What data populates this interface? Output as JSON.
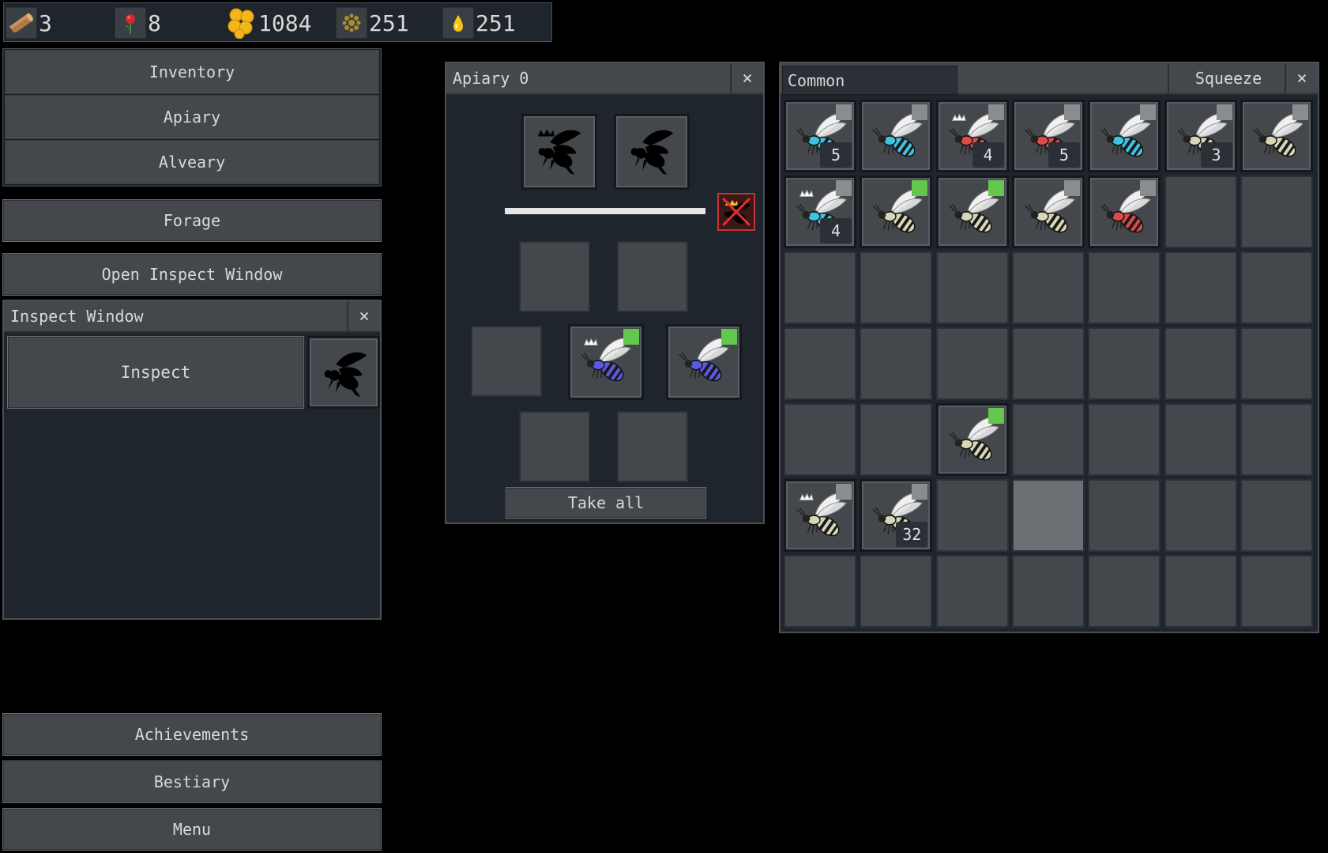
{
  "resources": [
    {
      "icon": "wood-icon",
      "value": "3"
    },
    {
      "icon": "flower-icon",
      "value": "8"
    },
    {
      "icon": "honeycomb-icon",
      "value": "1084"
    },
    {
      "icon": "pollen-icon",
      "value": "251"
    },
    {
      "icon": "nectar-icon",
      "value": "251"
    }
  ],
  "nav": {
    "inventory": "Inventory",
    "apiary": "Apiary",
    "alveary": "Alveary",
    "forage": "Forage",
    "open_inspect": "Open Inspect Window",
    "achievements": "Achievements",
    "bestiary": "Bestiary",
    "menu": "Menu"
  },
  "inspect_window": {
    "title": "Inspect Window",
    "close": "×",
    "inspect_button": "Inspect"
  },
  "apiary_window": {
    "title": "Apiary 0",
    "close": "×",
    "take_all": "Take all",
    "progress": 1.0,
    "output_slots": [
      {
        "species": "blue",
        "role": "princess",
        "tag_color": "#63c74d"
      },
      {
        "species": "blue",
        "role": "drone",
        "tag_color": "#63c74d"
      }
    ]
  },
  "inventory_window": {
    "filter_value": "Common",
    "squeeze_button": "Squeeze",
    "close": "×",
    "rows": [
      [
        {
          "species": "cyan",
          "crown": false,
          "tag": "gray",
          "count": "5"
        },
        {
          "species": "cyan",
          "crown": false,
          "tag": "gray",
          "count": ""
        },
        {
          "species": "red",
          "crown": true,
          "tag": "gray",
          "count": "4"
        },
        {
          "species": "red",
          "crown": false,
          "tag": "gray",
          "count": "5"
        },
        {
          "species": "cyan",
          "crown": false,
          "tag": "gray",
          "count": ""
        },
        {
          "species": "plain",
          "crown": false,
          "tag": "gray",
          "count": "3"
        },
        {
          "species": "plain",
          "crown": false,
          "tag": "gray",
          "count": ""
        }
      ],
      [
        {
          "species": "cyan",
          "crown": true,
          "tag": "gray",
          "count": "4"
        },
        {
          "species": "plain",
          "crown": false,
          "tag": "green",
          "count": ""
        },
        {
          "species": "plain",
          "crown": false,
          "tag": "green",
          "count": ""
        },
        {
          "species": "plain",
          "crown": false,
          "tag": "gray",
          "count": ""
        },
        {
          "species": "red",
          "crown": false,
          "tag": "gray",
          "count": ""
        },
        null,
        null
      ],
      [
        null,
        null,
        null,
        null,
        null,
        null,
        null
      ],
      [
        null,
        null,
        null,
        null,
        null,
        null,
        null
      ],
      [
        null,
        null,
        {
          "species": "plain",
          "crown": false,
          "tag": "green",
          "count": ""
        },
        null,
        null,
        null,
        null
      ],
      [
        {
          "species": "plain",
          "crown": true,
          "tag": "gray",
          "count": ""
        },
        {
          "species": "plain",
          "crown": false,
          "tag": "gray",
          "count": "32"
        },
        null,
        "highlight",
        null,
        null,
        null
      ],
      [
        null,
        null,
        null,
        null,
        null,
        null,
        null
      ]
    ]
  },
  "colors": {
    "cyan": "#3fc3e0",
    "red": "#e04a4a",
    "plain": "#d9d6b8",
    "blue": "#5a5ae0",
    "tag_gray": "#8a8d90",
    "tag_green": "#63c74d"
  }
}
